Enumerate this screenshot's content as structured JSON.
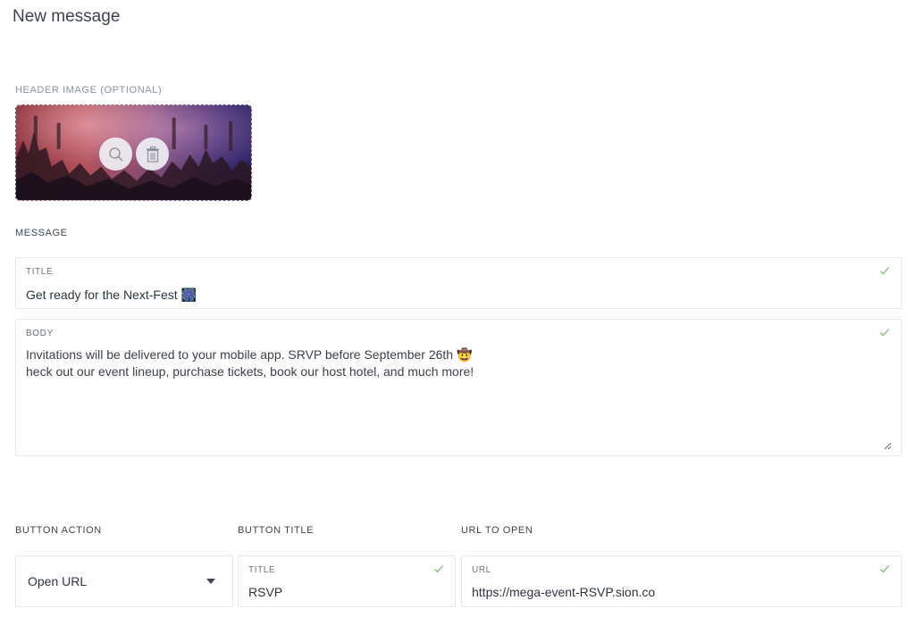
{
  "page": {
    "title": "New message"
  },
  "header_image": {
    "label": "HEADER IMAGE (OPTIONAL)",
    "zoom_icon": "search-icon",
    "delete_icon": "trash-icon"
  },
  "message": {
    "label": "MESSAGE",
    "title_field": {
      "label": "TITLE",
      "value": "Get ready for the Next-Fest 🎆"
    },
    "body_field": {
      "label": "BODY",
      "line1": "Invitations will be delivered to your mobile app. SRVP before September 26th 🤠",
      "line2": "heck out our event lineup, purchase tickets, book our host hotel, and much more!"
    }
  },
  "button_action": {
    "label": "BUTTON ACTION",
    "selected": "Open URL"
  },
  "button_title": {
    "label": "BUTTON TITLE",
    "field_label": "TITLE",
    "value": "RSVP"
  },
  "url_to_open": {
    "label": "URL TO OPEN",
    "field_label": "URL",
    "value": "https://mega-event-RSVP.sion.co"
  },
  "colors": {
    "check": "#7bbf73",
    "label": "#8a93a2",
    "border": "#e6e8ec"
  }
}
